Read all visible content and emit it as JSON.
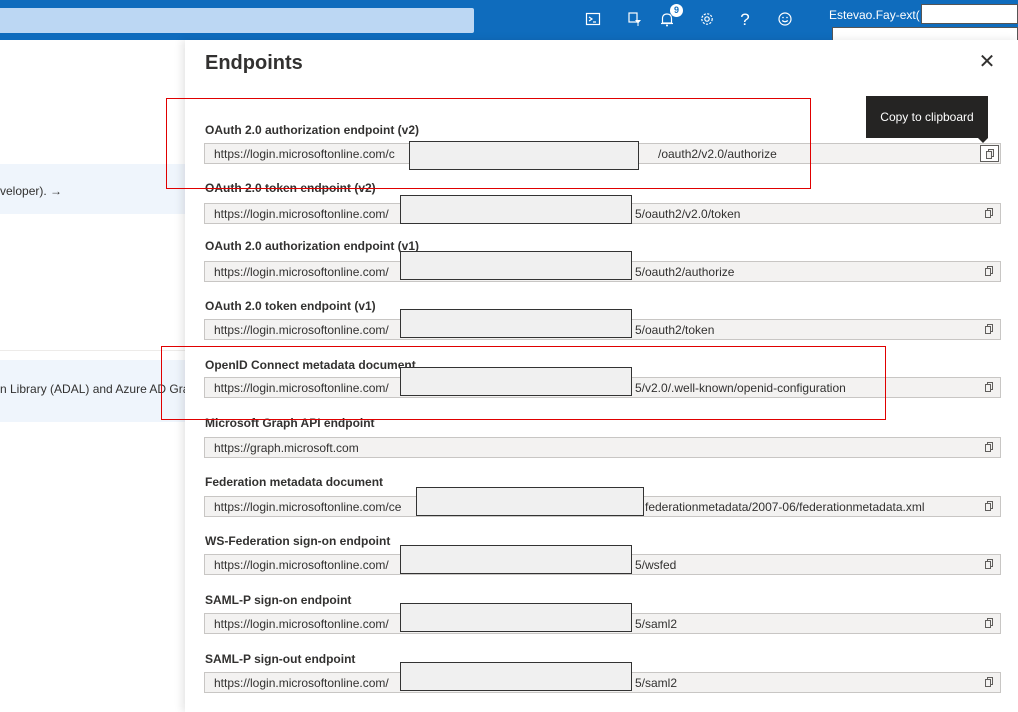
{
  "topbar": {
    "notification_count": "9",
    "user_name": "Estevao.Fay-ext(",
    "icons": [
      "cloud-shell-icon",
      "directory-filter-icon",
      "notifications-icon",
      "settings-icon",
      "help-icon",
      "feedback-icon"
    ]
  },
  "left": {
    "banner1_text": "veloper). →",
    "banner2_text": "n Library (ADAL) and Azure AD Grap"
  },
  "panel": {
    "title": "Endpoints",
    "tooltip": "Copy to clipboard",
    "endpoints": [
      {
        "label": "OAuth 2.0 authorization endpoint (v2)",
        "prefix": "https://login.microsoftonline.com/c",
        "suffix": "/oauth2/v2.0/authorize"
      },
      {
        "label": "OAuth 2.0 token endpoint (v2)",
        "prefix": "https://login.microsoftonline.com/",
        "suffix": "5/oauth2/v2.0/token"
      },
      {
        "label": "OAuth 2.0 authorization endpoint (v1)",
        "prefix": "https://login.microsoftonline.com/",
        "suffix": "5/oauth2/authorize"
      },
      {
        "label": "OAuth 2.0 token endpoint (v1)",
        "prefix": "https://login.microsoftonline.com/",
        "suffix": "5/oauth2/token"
      },
      {
        "label": "OpenID Connect metadata document",
        "prefix": "https://login.microsoftonline.com/",
        "suffix": "5/v2.0/.well-known/openid-configuration"
      },
      {
        "label": "Microsoft Graph API endpoint",
        "prefix": "https://graph.microsoft.com",
        "suffix": ""
      },
      {
        "label": "Federation metadata document",
        "prefix": "https://login.microsoftonline.com/ce",
        "suffix": "federationmetadata/2007-06/federationmetadata.xml"
      },
      {
        "label": "WS-Federation sign-on endpoint",
        "prefix": "https://login.microsoftonline.com/",
        "suffix": "5/wsfed"
      },
      {
        "label": "SAML-P sign-on endpoint",
        "prefix": "https://login.microsoftonline.com/",
        "suffix": "5/saml2"
      },
      {
        "label": "SAML-P sign-out endpoint",
        "prefix": "https://login.microsoftonline.com/",
        "suffix": "5/saml2"
      }
    ]
  }
}
